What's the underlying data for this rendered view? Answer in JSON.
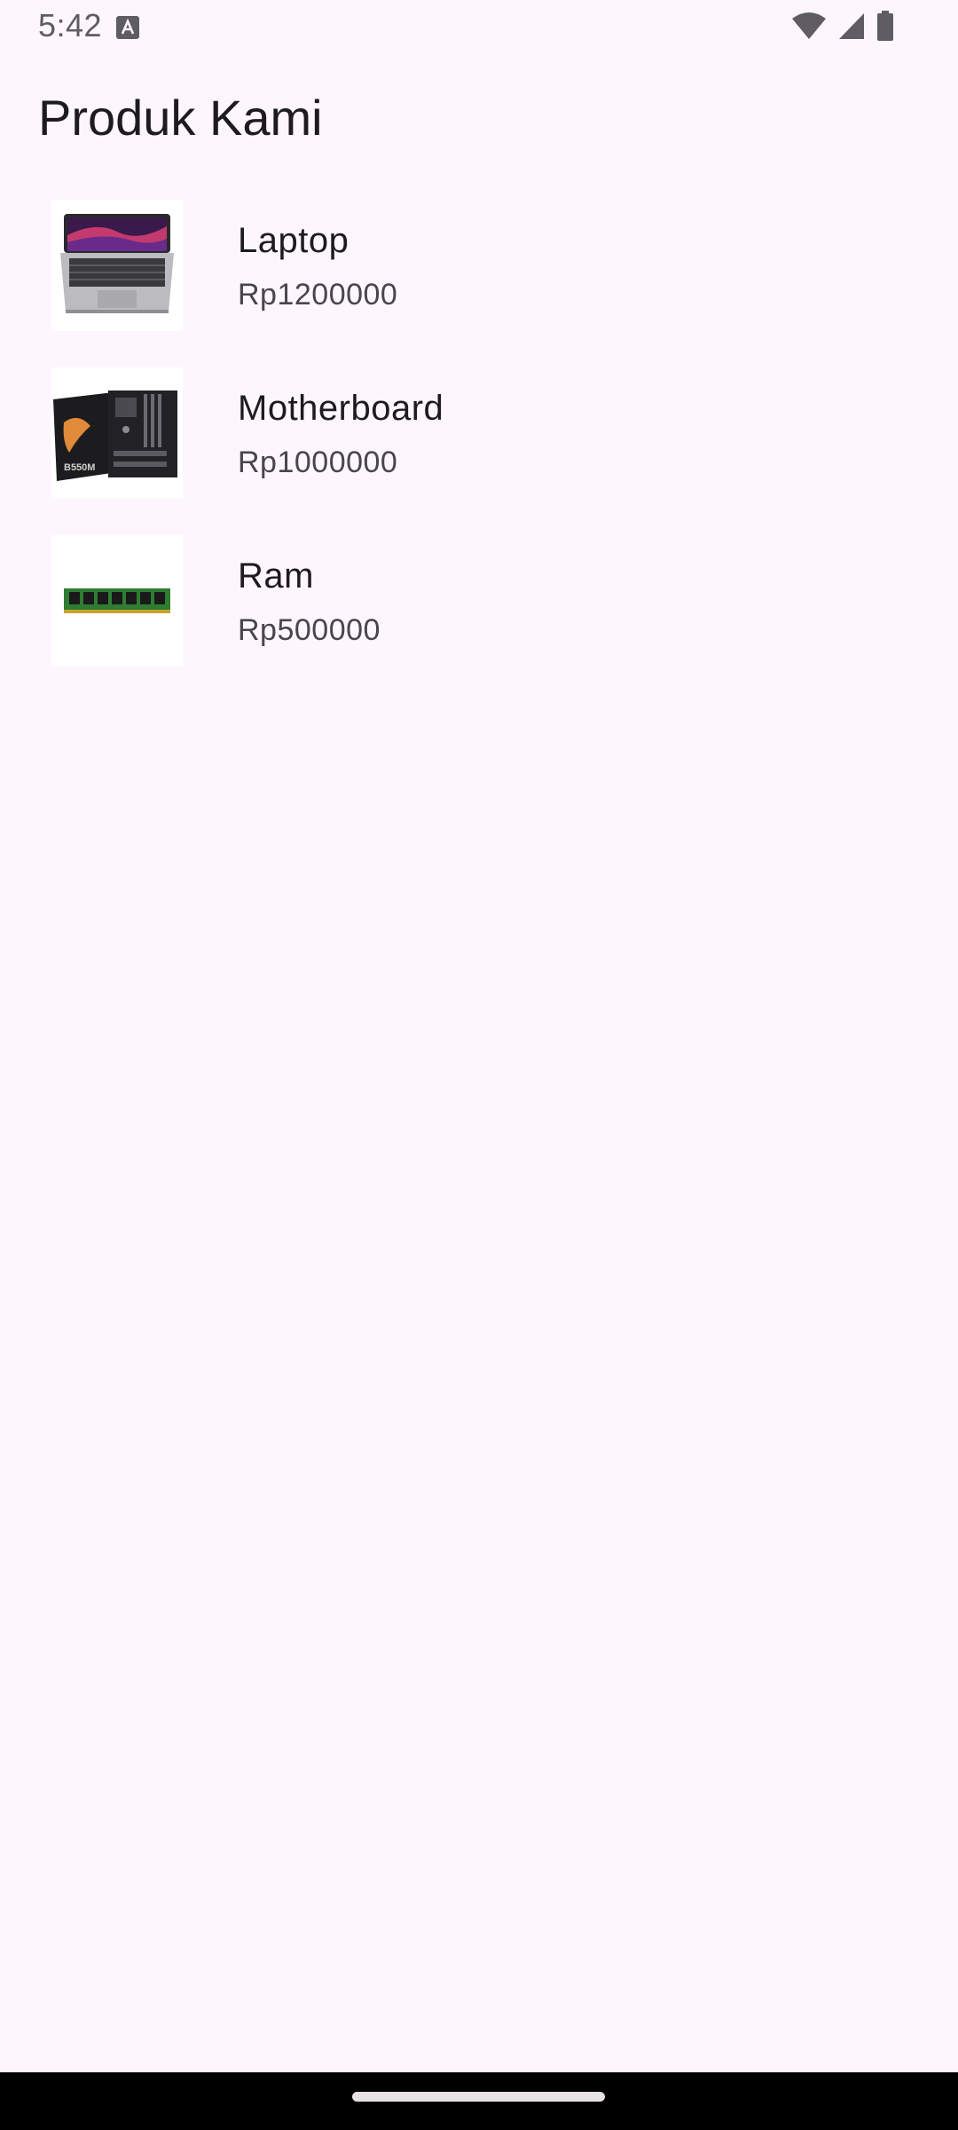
{
  "status_bar": {
    "time": "5:42",
    "icons": [
      "keyboard-a-icon",
      "wifi-icon",
      "cell-signal-icon",
      "battery-icon"
    ]
  },
  "header": {
    "title": "Produk Kami"
  },
  "products": [
    {
      "name": "Laptop",
      "price": "Rp1200000",
      "image_icon": "laptop-image"
    },
    {
      "name": "Motherboard",
      "price": "Rp1000000",
      "image_icon": "motherboard-image"
    },
    {
      "name": "Ram",
      "price": "Rp500000",
      "image_icon": "ram-image"
    }
  ],
  "colors": {
    "background": "#fdf7fd",
    "text_primary": "#1d1b20",
    "text_secondary": "#49454f"
  }
}
